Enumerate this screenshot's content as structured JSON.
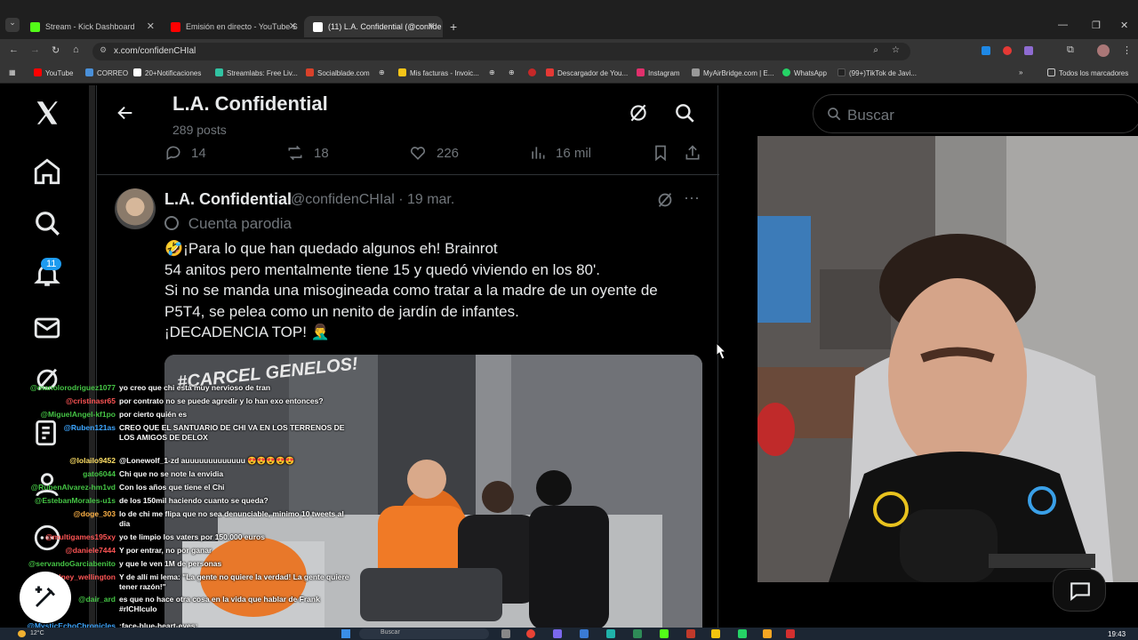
{
  "browser": {
    "tabs": [
      {
        "label": "Stream - Kick Dashboard",
        "color": "#53fc18"
      },
      {
        "label": "Emisión en directo - YouTube S",
        "color": "#ff0000"
      },
      {
        "label": "(11) L.A. Confidential (@confide",
        "color": "#ffffff"
      }
    ],
    "new_tab_label": "+",
    "url": "x.com/confidenCHIal",
    "bookmarks": [
      {
        "label": "YouTube",
        "color": "#ff0000"
      },
      {
        "label": "CORREO",
        "color": "#4a90d9"
      },
      {
        "label": "20+Notificaciones",
        "color": "#ffffff"
      },
      {
        "label": "Streamlabs: Free Liv...",
        "color": "#31c3a2"
      },
      {
        "label": "Socialblade.com",
        "color": "#d9412a"
      },
      {
        "label": "Mis facturas - Invoic...",
        "color": "#f5c518"
      },
      {
        "label": "Descargador de You...",
        "color": "#e53935"
      },
      {
        "label": "Instagram",
        "color": "#e1306c"
      },
      {
        "label": "MyAirBridge.com | E...",
        "color": "#999999"
      },
      {
        "label": "WhatsApp",
        "color": "#25d366"
      },
      {
        "label": "(99+)TikTok de Javi...",
        "color": "#222222"
      }
    ],
    "all_bookmarks_label": "Todos los marcadores"
  },
  "nav": {
    "notification_count": "11"
  },
  "profile_header": {
    "title": "L.A. Confidential",
    "post_count": "289 posts"
  },
  "prev_post_metrics": {
    "replies": "14",
    "reposts": "18",
    "likes": "226",
    "views": "16 mil"
  },
  "post": {
    "display_name": "L.A. Confidential",
    "handle_date": "@confidenCHIal · 19 mar.",
    "parody_label": "Cuenta parodia",
    "lines": [
      "🤣¡Para lo que han quedado algunos eh! Brainrot",
      "54 anitos pero mentalmente tiene 15 y quedó viviendo en los 80'.",
      "Si no se manda una misogineada como tratar a la madre de un oyente de",
      "P5T4, se pelea como un nenito de jardín de infantes.",
      "¡DECADENCIA TOP! 🤦‍♂️"
    ],
    "media_watermark": "#CARCEL GENELOS!"
  },
  "search": {
    "placeholder": "Buscar"
  },
  "chat": [
    {
      "user": "@manolorodriguez1077",
      "color": "#45c545",
      "msg": "yo creo que chi está muy nervioso de tran"
    },
    {
      "user": "@cristinasr65",
      "color": "#ff5555",
      "msg": "por contrato no se puede agredir y lo han exo entonces?"
    },
    {
      "user": "@MiguelAngel-kf1po",
      "color": "#45c545",
      "msg": "por cierto quién es"
    },
    {
      "user": "@Ruben121as",
      "color": "#3ea6ff",
      "msg": "CREO QUE EL SANTUARIO DE CHI VA EN LOS TERRENOS DE LOS AMIGOS DE DELOX"
    },
    {
      "user": "@lolailo9452",
      "color": "#ffe066",
      "msg": "@Lonewolf_1-zd auuuuuuuuuuuuu 😍😍😍😍😍"
    },
    {
      "user": "gato6044",
      "color": "#45c545",
      "msg": "Chi que no se note la envidia"
    },
    {
      "user": "@RubenAlvarez-hm1vd",
      "color": "#45c545",
      "msg": "Con los años que tiene el Chi"
    },
    {
      "user": "@EstebanMorales-u1s",
      "color": "#45c545",
      "msg": "de los 150mil haciendo cuanto se queda?"
    },
    {
      "user": "@doge_303",
      "color": "#ffb347",
      "msg": "lo de chi me flipa que no sea denunciable, minimo 10 tweets al dia"
    },
    {
      "user": "@multigames195xy",
      "color": "#ff5555",
      "msg": "yo te limpio los vaters por 150.000 euros"
    },
    {
      "user": "@daniele7444",
      "color": "#ff5555",
      "msg": "Y por entrar, no por ganar"
    },
    {
      "user": "@servandoGarciabenito",
      "color": "#45c545",
      "msg": "y que le ven 1M de personas"
    },
    {
      "user": "@sydney_wellington",
      "color": "#ff5555",
      "msg": "Y de allí mi lema: \"La gente no quiere la verdad! La gente quiere tener razón!\""
    },
    {
      "user": "@dair_ard",
      "color": "#45c545",
      "msg": "es que no hace otra cosa en la vida que hablar de Frank #rICHIculo"
    },
    {
      "user": "@MysticEchoChronicles",
      "color": "#3ea6ff",
      "msg": ":face-blue-heart-eyes:"
    }
  ],
  "taskbar": {
    "temperature": "12°C",
    "search_label": "Buscar",
    "clock": "19:43"
  },
  "colors": {
    "x_background": "#000000",
    "x_text": "#e7e9ea",
    "x_secondary": "#71767b",
    "x_accent": "#1d9bf0"
  }
}
